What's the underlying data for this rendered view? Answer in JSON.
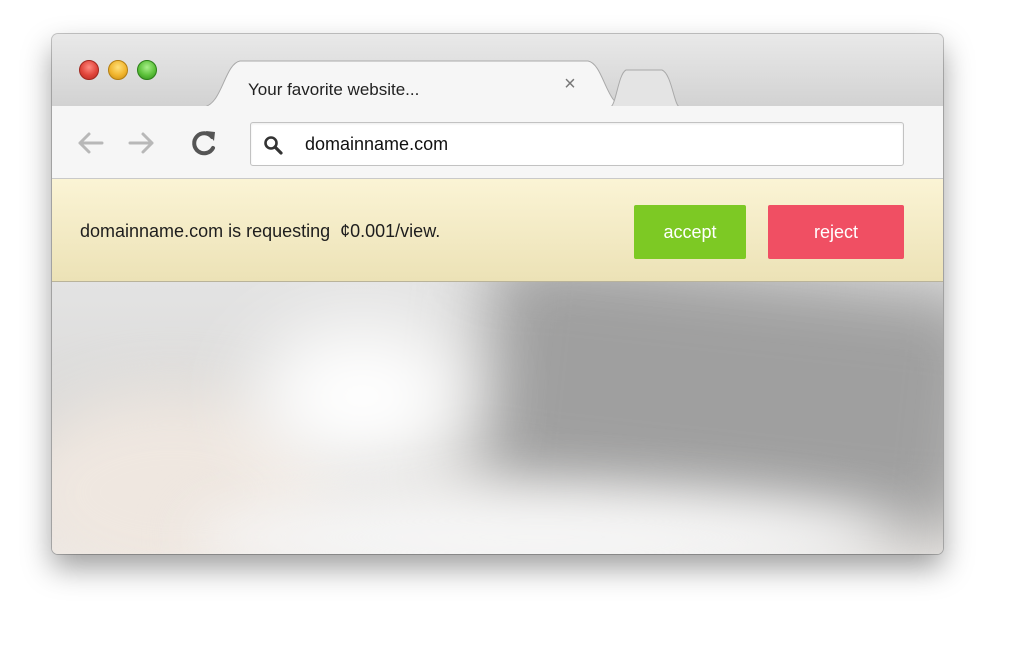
{
  "tab": {
    "title": "Your favorite website...",
    "close_glyph": "×"
  },
  "toolbar": {
    "back_icon": "back-arrow-icon",
    "forward_icon": "forward-arrow-icon",
    "reload_icon": "reload-icon"
  },
  "address_bar": {
    "icon": "search-icon",
    "value": "domainname.com"
  },
  "infobar": {
    "message": "domainname.com is requesting  ¢0.001/view.",
    "accept_label": "accept",
    "reject_label": "reject"
  },
  "colors": {
    "accept": "#7dc924",
    "reject": "#f04f63",
    "infobar_bg": "#f6efcc"
  }
}
